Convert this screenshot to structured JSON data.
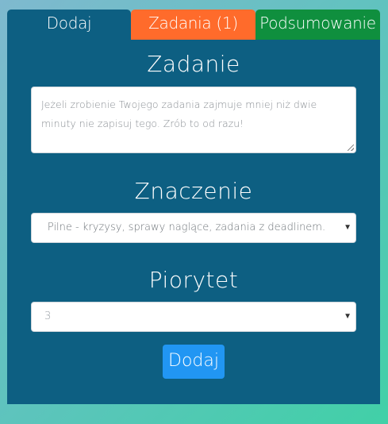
{
  "colors": {
    "panel": "#0d5f82",
    "tab_add": "#0d5f82",
    "tab_tasks": "#ff6b2b",
    "tab_summary": "#0f8f3e",
    "button": "#2196f3"
  },
  "tabs": {
    "add": "Dodaj",
    "tasks": "Zadania (1)",
    "summary": "Podsumowanie"
  },
  "form": {
    "task_title": "Zadanie",
    "task_placeholder": "Jeżeli zrobienie Twojego zadania zajmuje mniej niż dwie minuty nie zapisuj tego. Zrób to od razu!",
    "importance_title": "Znaczenie",
    "importance_value": "Pilne - kryzysy, sprawy naglące, zadania z deadlinem.",
    "priority_title": "Piorytet",
    "priority_value": "3",
    "submit_label": "Dodaj"
  }
}
